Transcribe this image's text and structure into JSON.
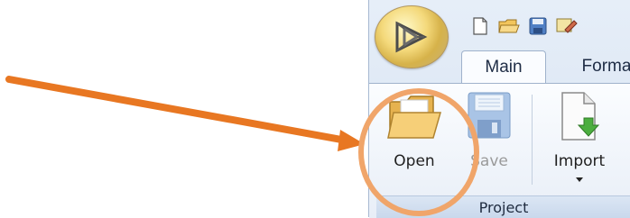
{
  "tabs": {
    "main": "Main",
    "format": "Forma"
  },
  "ribbon": {
    "open_label": "Open",
    "save_label": "Save",
    "import_label": "Import",
    "group_label": "Project"
  },
  "icons": {
    "app_button": "app-logo-icon",
    "qat": [
      "new-document-icon",
      "open-folder-icon",
      "save-icon",
      "edit-icon"
    ],
    "open": "folder-icon",
    "save": "floppy-disk-icon",
    "import": "import-document-icon"
  },
  "colors": {
    "annotation_arrow": "#e87722",
    "annotation_circle": "#f0a56a"
  }
}
